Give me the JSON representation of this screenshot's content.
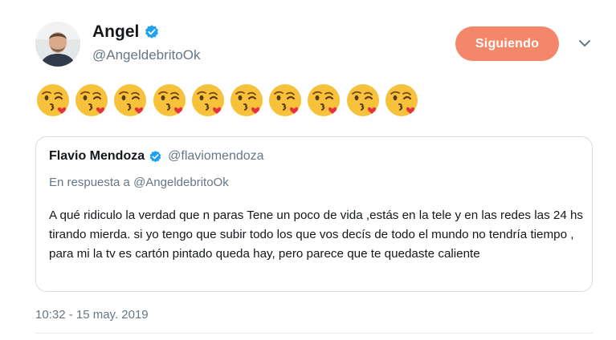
{
  "author": {
    "name": "Angel",
    "handle": "@AngeldebritoOk"
  },
  "follow_button": {
    "label": "Siguiendo"
  },
  "emojis": {
    "icon": "face-blowing-a-kiss-icon",
    "count": 10
  },
  "quoted_tweet": {
    "name": "Flavio Mendoza",
    "handle": "@flaviomendoza",
    "reply_prefix": "En respuesta a",
    "reply_to": "@AngeldebritoOk",
    "text": "A qué ridiculo la verdad que n paras Tene un poco de vida ,estás en la tele y en las redes las 24 hs tirando mierda. si yo tengo que subir todo los que vos decís de todo el mundo no tendría tiempo , para mi la tv es cartón pintado queda hay, pero parece que te quedaste caliente"
  },
  "timestamp": "10:32 - 15 may. 2019",
  "colors": {
    "follow_bg": "#f4876a",
    "verified": "#1da1f2",
    "secondary_text": "#657786"
  }
}
